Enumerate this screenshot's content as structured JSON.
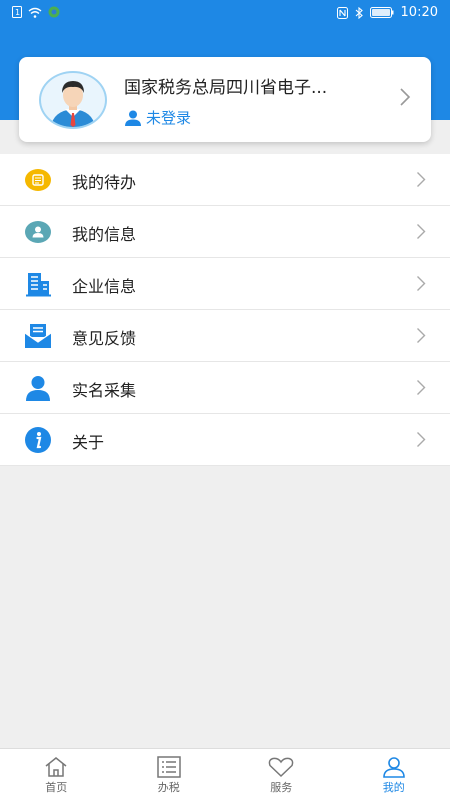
{
  "status_bar": {
    "time": "10:20"
  },
  "profile": {
    "org_name": "国家税务总局四川省电子...",
    "login_status": "未登录"
  },
  "menu": [
    {
      "label": "我的待办",
      "icon": "todo-icon",
      "color": "#f5b800"
    },
    {
      "label": "我的信息",
      "icon": "user-info-icon",
      "color": "#5ba7b5"
    },
    {
      "label": "企业信息",
      "icon": "building-icon",
      "color": "#1e88e5"
    },
    {
      "label": "意见反馈",
      "icon": "feedback-mail-icon",
      "color": "#1e88e5"
    },
    {
      "label": "实名采集",
      "icon": "person-icon",
      "color": "#1e88e5"
    },
    {
      "label": "关于",
      "icon": "info-icon",
      "color": "#1e88e5"
    }
  ],
  "bottom_nav": [
    {
      "label": "首页",
      "icon": "home-icon",
      "active": false
    },
    {
      "label": "办税",
      "icon": "list-icon",
      "active": false
    },
    {
      "label": "服务",
      "icon": "heart-icon",
      "active": false
    },
    {
      "label": "我的",
      "icon": "user-icon",
      "active": true
    }
  ],
  "colors": {
    "brand": "#1e88e5",
    "background": "#efefef",
    "active_tab": "#1e88e5"
  }
}
